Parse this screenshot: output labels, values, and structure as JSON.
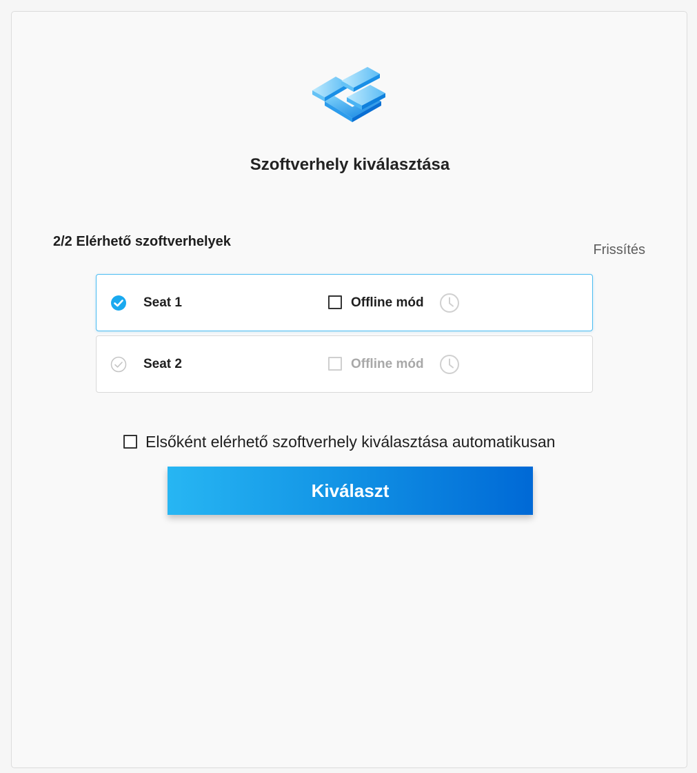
{
  "dialog": {
    "title": "Szoftverhely kiválasztása",
    "available_label": "2/2 Elérhető szoftverhelyek",
    "refresh_label": "Frissítés"
  },
  "seats": [
    {
      "name": "Seat 1",
      "selected": true,
      "offline_label": "Offline mód",
      "offline_checked": false,
      "offline_enabled": true
    },
    {
      "name": "Seat 2",
      "selected": false,
      "offline_label": "Offline mód",
      "offline_checked": false,
      "offline_enabled": false
    }
  ],
  "auto_select": {
    "label": "Elsőként elérhető szoftverhely kiválasztása automatikusan",
    "checked": false
  },
  "select_button": {
    "label": "Kiválaszt"
  },
  "icons": {
    "logo": "stacked-blocks-logo",
    "selected": "check-circle-filled-icon",
    "unselected": "check-circle-outline-icon",
    "clock": "clock-icon"
  },
  "colors": {
    "accent": "#1aa9ef",
    "button_gradient_start": "#27b6f3",
    "button_gradient_end": "#0069d6",
    "muted": "#a8a8a8"
  }
}
